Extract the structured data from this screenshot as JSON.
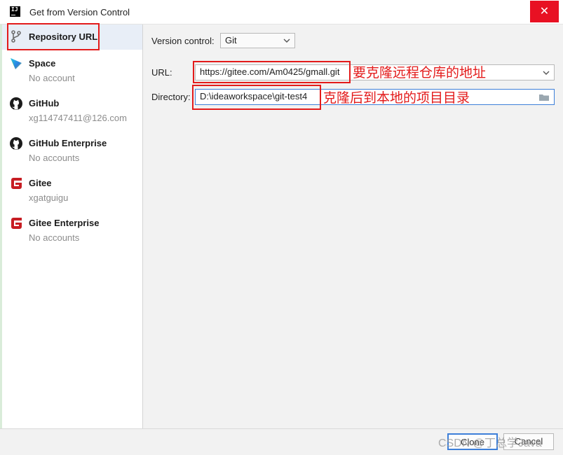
{
  "window": {
    "title": "Get from Version Control",
    "close_glyph": "✕",
    "app_icon": "IJ"
  },
  "sidebar": {
    "items": [
      {
        "name": "Repository URL",
        "sub": "",
        "icon": "git-branch-icon"
      },
      {
        "name": "Space",
        "sub": "No account",
        "icon": "space-icon"
      },
      {
        "name": "GitHub",
        "sub": "xg114747411@126.com",
        "icon": "github-icon"
      },
      {
        "name": "GitHub Enterprise",
        "sub": "No accounts",
        "icon": "github-icon"
      },
      {
        "name": "Gitee",
        "sub": "xgatguigu",
        "icon": "gitee-icon"
      },
      {
        "name": "Gitee Enterprise",
        "sub": "No accounts",
        "icon": "gitee-icon"
      }
    ]
  },
  "form": {
    "version_control_label": "Version control:",
    "version_control_value": "Git",
    "url_label": "URL:",
    "url_value": "https://gitee.com/Am0425/gmall.git",
    "directory_label": "Directory:",
    "directory_value": "D:\\ideaworkspace\\git-test4"
  },
  "annotations": {
    "url_note": "要克隆远程仓库的地址",
    "directory_note": "克隆后到本地的项目目录"
  },
  "buttons": {
    "clone": "Clone",
    "cancel": "Cancel"
  },
  "watermark": "CSDN @丁总学Java",
  "colors": {
    "accent": "#3d7fd9",
    "annotation": "#e31b1b",
    "close": "#e81123",
    "gitee": "#c71d23"
  }
}
